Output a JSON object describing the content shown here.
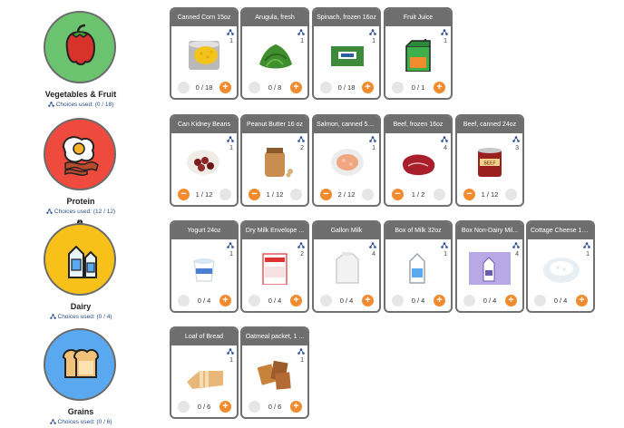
{
  "categories": [
    {
      "name": "Vegetables & Fruit",
      "used": "Choices used: (0 / 18)",
      "color": "#6cc36f",
      "icon": "pepper-icon"
    },
    {
      "name": "Protein",
      "used": "Choices used: (12 / 12)",
      "color": "#ee4b3e",
      "icon": "egg-bacon-icon"
    },
    {
      "name": "Dairy",
      "used": "Choices used: (0 / 4)",
      "color": "#f7c11a",
      "icon": "milk-icon"
    },
    {
      "name": "Grains",
      "used": "Choices used: (0 / 6)",
      "color": "#5aa8f0",
      "icon": "bread-icon"
    }
  ],
  "dairy_badge": "1",
  "rows": [
    [
      {
        "title": "Canned Corn 15oz",
        "qty": "1",
        "count": "0 / 18",
        "minus": false,
        "plus": true,
        "img": "corn"
      },
      {
        "title": "Arugula, fresh",
        "qty": "1",
        "count": "0 / 8",
        "minus": false,
        "plus": true,
        "img": "arugula"
      },
      {
        "title": "Spinach, frozen 16oz",
        "qty": "1",
        "count": "0 / 18",
        "minus": false,
        "plus": true,
        "img": "spinach"
      },
      {
        "title": "Fruit Juice",
        "qty": "1",
        "count": "0 / 1",
        "minus": false,
        "plus": true,
        "img": "juice"
      }
    ],
    [
      {
        "title": "Can Kidney Beans",
        "qty": "1",
        "count": "1 / 12",
        "minus": true,
        "plus": false,
        "img": "beans"
      },
      {
        "title": "Peanut Butter 16 oz",
        "qty": "2",
        "count": "1 / 12",
        "minus": true,
        "plus": false,
        "img": "pb"
      },
      {
        "title": "Salmon, canned 5o...",
        "qty": "1",
        "count": "2 / 12",
        "minus": true,
        "plus": false,
        "img": "salmon"
      },
      {
        "title": "Beef, frozen 16oz",
        "qty": "4",
        "count": "1 / 2",
        "minus": true,
        "plus": false,
        "img": "beef"
      },
      {
        "title": "Beef, canned 24oz",
        "qty": "3",
        "count": "1 / 12",
        "minus": true,
        "plus": false,
        "img": "beefcan"
      }
    ],
    [
      {
        "title": "Yogurt 24oz",
        "qty": "1",
        "count": "0 / 4",
        "minus": false,
        "plus": true,
        "img": "yogurt"
      },
      {
        "title": "Dry Milk Envelope ...",
        "qty": "2",
        "count": "0 / 4",
        "minus": false,
        "plus": true,
        "img": "drymilk"
      },
      {
        "title": "Gallon Milk",
        "qty": "4",
        "count": "0 / 4",
        "minus": false,
        "plus": true,
        "img": "gallon"
      },
      {
        "title": "Box of Milk 32oz",
        "qty": "1",
        "count": "0 / 4",
        "minus": false,
        "plus": true,
        "img": "milkbox"
      },
      {
        "title": "Box Non-Dairy Mil...",
        "qty": "4",
        "count": "0 / 4",
        "minus": false,
        "plus": true,
        "img": "nondairy"
      },
      {
        "title": "Cottage Cheese 16...",
        "qty": "1",
        "count": "0 / 4",
        "minus": false,
        "plus": true,
        "img": "cottage"
      }
    ],
    [
      {
        "title": "Loaf of Bread",
        "qty": "1",
        "count": "0 / 6",
        "minus": false,
        "plus": true,
        "img": "bread"
      },
      {
        "title": "Oatmeal packet, 1 ...",
        "qty": "1",
        "count": "0 / 6",
        "minus": false,
        "plus": true,
        "img": "oatmeal"
      }
    ]
  ],
  "minus_symbol": "−",
  "plus_symbol": "+",
  "accent": "#f28a2e"
}
